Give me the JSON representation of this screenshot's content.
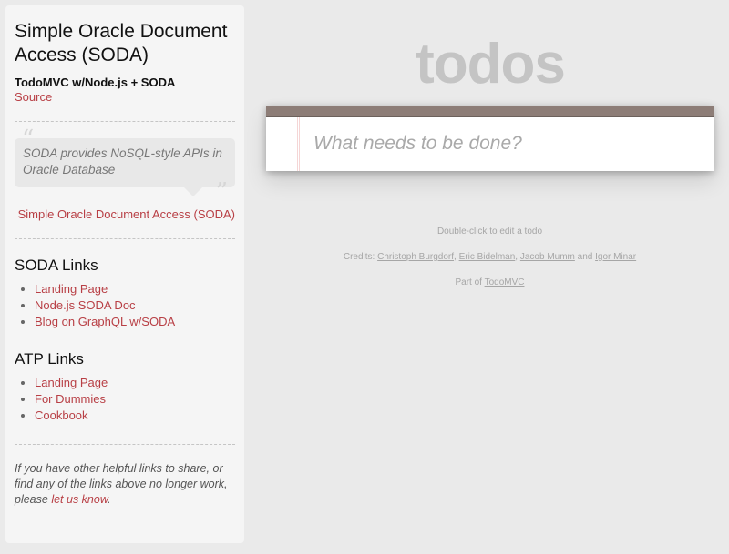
{
  "sidebar": {
    "title": "Simple Oracle Document Access (SODA)",
    "subtitle": "TodoMVC w/Node.js + SODA",
    "source_link": "Source",
    "quote": {
      "text": "SODA provides NoSQL-style APIs in Oracle Database",
      "open_mark": "“",
      "close_mark": "”",
      "source": "Simple Oracle Document Access (SODA)"
    },
    "sections": [
      {
        "heading": "SODA Links",
        "links": [
          "Landing Page",
          "Node.js SODA Doc",
          "Blog on GraphQL w/SODA"
        ]
      },
      {
        "heading": "ATP Links",
        "links": [
          "Landing Page",
          "For Dummies",
          "Cookbook"
        ]
      }
    ],
    "footnote": {
      "text_before": "If you have other helpful links to share, or find any of the links above no longer work, please ",
      "link": "let us know",
      "text_after": "."
    }
  },
  "app": {
    "title": "todos",
    "new_todo_placeholder": "What needs to be done?",
    "new_todo_value": ""
  },
  "info": {
    "hint": "Double-click to edit a todo",
    "credits_label": "Credits:",
    "credits": [
      "Christoph Burgdorf",
      "Eric Bidelman",
      "Jacob Mumm",
      "Igor Minar"
    ],
    "credits_sep": ",",
    "credits_and": "and",
    "part_of_label": "Part of",
    "part_of_link": "TodoMVC"
  },
  "colors": {
    "accent": "#b83f45",
    "band": "#8d7d77",
    "background": "#eaeaea",
    "sidebar_bg": "#f5f5f5"
  }
}
